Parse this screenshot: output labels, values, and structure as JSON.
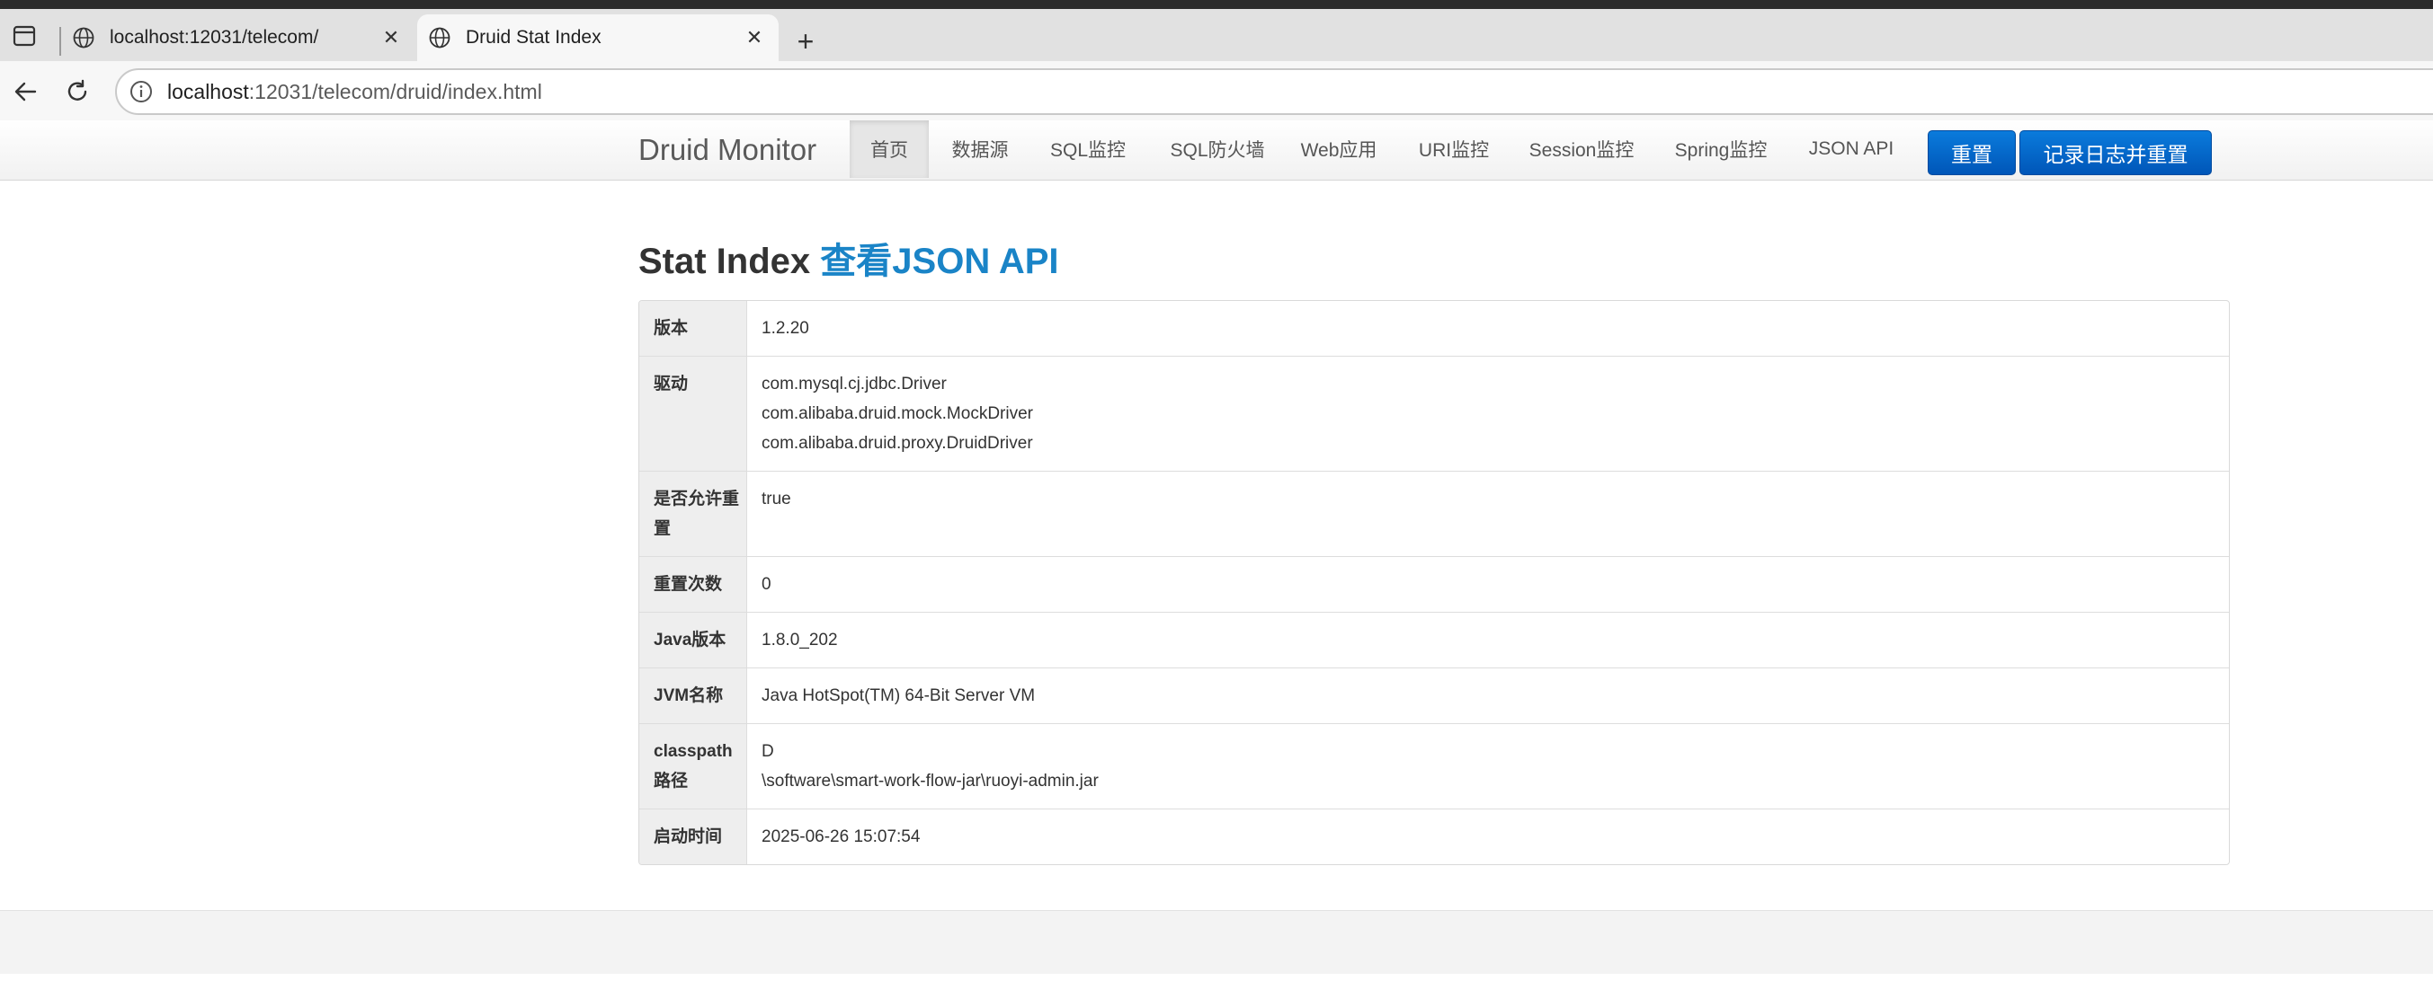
{
  "browser": {
    "tabs": [
      {
        "title": "localhost:12031/telecom/",
        "active": false
      },
      {
        "title": "Druid Stat Index",
        "active": true
      }
    ],
    "url": {
      "host": "localhost",
      "rest": ":12031/telecom/druid/index.html"
    }
  },
  "nav": {
    "brand": "Druid Monitor",
    "items": [
      "首页",
      "数据源",
      "SQL监控",
      "SQL防火墙",
      "Web应用",
      "URI监控",
      "Session监控",
      "Spring监控",
      "JSON API"
    ],
    "active_index": 0,
    "reset_label": "重置",
    "log_reset_label": "记录日志并重置"
  },
  "page": {
    "title": "Stat Index",
    "json_link": "查看JSON API"
  },
  "stats": [
    {
      "label": "版本",
      "lines": [
        "1.2.20"
      ]
    },
    {
      "label": "驱动",
      "lines": [
        "com.mysql.cj.jdbc.Driver",
        "com.alibaba.druid.mock.MockDriver",
        "com.alibaba.druid.proxy.DruidDriver"
      ]
    },
    {
      "label": "是否允许重置",
      "lines": [
        "true"
      ]
    },
    {
      "label": "重置次数",
      "lines": [
        "0"
      ]
    },
    {
      "label": "Java版本",
      "lines": [
        "1.8.0_202"
      ]
    },
    {
      "label": "JVM名称",
      "lines": [
        "Java HotSpot(TM) 64-Bit Server VM"
      ]
    },
    {
      "label": "classpath路径",
      "lines": [
        "D",
        "\\software\\smart-work-flow-jar\\ruoyi-admin.jar"
      ]
    },
    {
      "label": "启动时间",
      "lines": [
        "2025-06-26 15:07:54"
      ]
    }
  ],
  "colors": {
    "primary_button": "#0066cc",
    "link": "#1a84c7"
  }
}
